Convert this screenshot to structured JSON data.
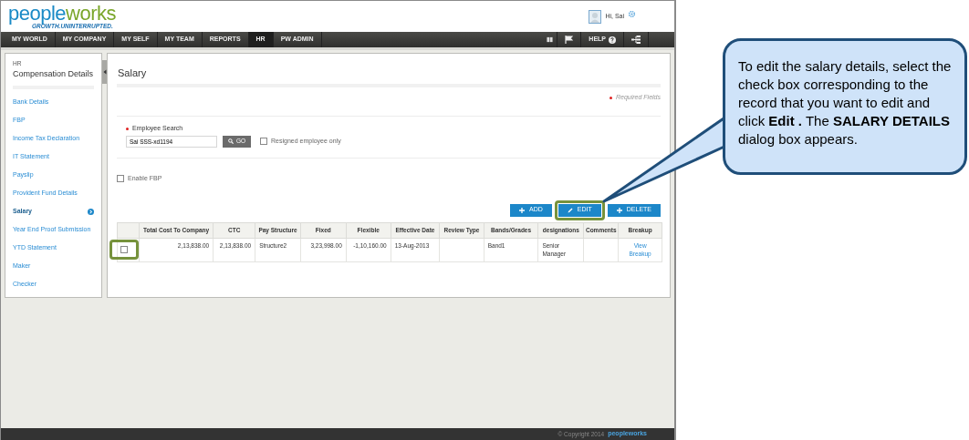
{
  "logo": {
    "parts": [
      {
        "text": "people",
        "color": "#1a8ac6"
      },
      {
        "text": "works",
        "color": "#7aa62a"
      }
    ],
    "tagline": "GROWTH.UNINTERRUPTED."
  },
  "user": {
    "greeting": "Hi, Sai"
  },
  "nav": [
    {
      "label": "MY WORLD",
      "selected": false
    },
    {
      "label": "MY COMPANY",
      "selected": false
    },
    {
      "label": "MY SELF",
      "selected": false
    },
    {
      "label": "MY TEAM",
      "selected": false
    },
    {
      "label": "REPORTS",
      "selected": false
    },
    {
      "label": "HR",
      "selected": true
    },
    {
      "label": "PW ADMIN",
      "selected": false
    }
  ],
  "help": {
    "label": "HELP"
  },
  "sidebar": {
    "section": "HR",
    "title": "Compensation Details",
    "items": [
      {
        "label": "Bank Details",
        "selected": false
      },
      {
        "label": "FBP",
        "selected": false
      },
      {
        "label": "Income Tax Declaration",
        "selected": false
      },
      {
        "label": "IT Statement",
        "selected": false
      },
      {
        "label": "Payslip",
        "selected": false
      },
      {
        "label": "Provident Fund Details",
        "selected": false
      },
      {
        "label": "Salary",
        "selected": true
      },
      {
        "label": "Year End Proof Submission",
        "selected": false
      },
      {
        "label": "YTD Statement",
        "selected": false
      },
      {
        "label": "Maker",
        "selected": false
      },
      {
        "label": "Checker",
        "selected": false
      }
    ]
  },
  "page": {
    "title": "Salary",
    "required_note": "Required Fields",
    "search_label": "Employee Search",
    "search_value": "Sai SSS-xd1194",
    "go_label": "GO",
    "resigned": {
      "label": "Resigned employee only",
      "checked": false
    },
    "enable_fbp": {
      "label": "Enable FBP",
      "checked": false
    }
  },
  "actions": [
    {
      "kind": "add",
      "label": "ADD",
      "highlighted": false
    },
    {
      "kind": "edit",
      "label": "EDIT",
      "highlighted": true
    },
    {
      "kind": "delete",
      "label": "DELETE",
      "highlighted": false
    }
  ],
  "table": {
    "columns": [
      {
        "label": "Total Cost To Company",
        "kind": "number"
      },
      {
        "label": "CTC",
        "kind": "number"
      },
      {
        "label": "Pay Structure",
        "kind": "text"
      },
      {
        "label": "Fixed",
        "kind": "number"
      },
      {
        "label": "Flexible",
        "kind": "number"
      },
      {
        "label": "Effective Date",
        "kind": "text"
      },
      {
        "label": "Review Type",
        "kind": "text"
      },
      {
        "label": "Bands/Grades",
        "kind": "text"
      },
      {
        "label": "designations",
        "kind": "text"
      },
      {
        "label": "Comments",
        "kind": "text"
      },
      {
        "label": "Breakup",
        "kind": "link"
      }
    ],
    "rows": [
      {
        "checked": false,
        "highlighted": true,
        "cells": [
          "2,13,838.00",
          "2,13,838.00",
          "Structure2",
          "3,23,998.00",
          "-1,10,160.00",
          "13-Aug-2013",
          null,
          "Band1",
          "Senior Manager",
          null,
          "View Breakup"
        ]
      }
    ]
  },
  "footer": {
    "copyright": "© Copyright 2014",
    "logo": "peopleworks"
  },
  "callout": {
    "text": "To edit the salary details, select the check box corresponding to the record that you want to edit and click **Edit .** The **SALARY DETAILS** dialog box appears."
  }
}
